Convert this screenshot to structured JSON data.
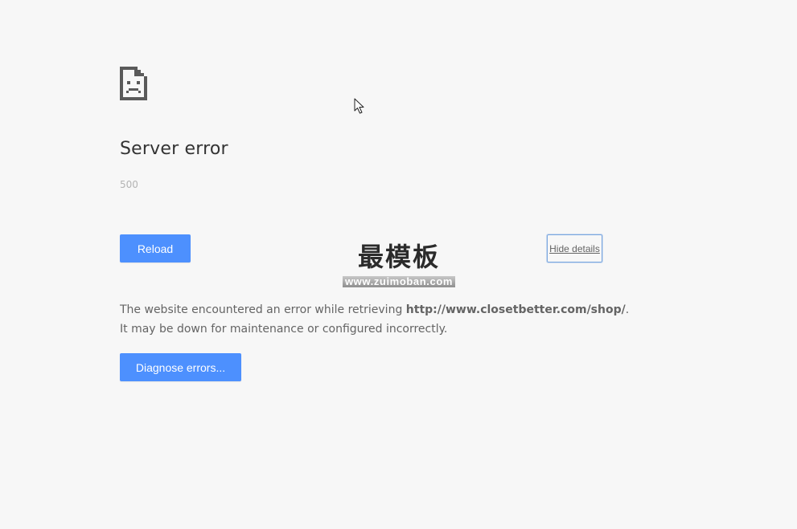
{
  "error": {
    "title": "Server error",
    "code": "500"
  },
  "buttons": {
    "reload_label": "Reload",
    "details_label": "Hide details",
    "diagnose_label": "Diagnose errors..."
  },
  "details": {
    "line1_prefix": "The website encountered an error while retrieving ",
    "url": "http://www.closetbetter.com/shop/",
    "line1_suffix": ".",
    "line2": "It may be down for maintenance or configured incorrectly."
  },
  "watermark": {
    "title": "最模板",
    "url": "www.zuimoban.com"
  },
  "icons": {
    "error": "sad-page-icon",
    "cursor": "mouse-cursor-icon"
  },
  "colors": {
    "background": "#f7f7f7",
    "button_blue": "#4d90fe",
    "title_text": "#333333",
    "body_text": "#646464",
    "code_text": "#b3b3b3"
  }
}
